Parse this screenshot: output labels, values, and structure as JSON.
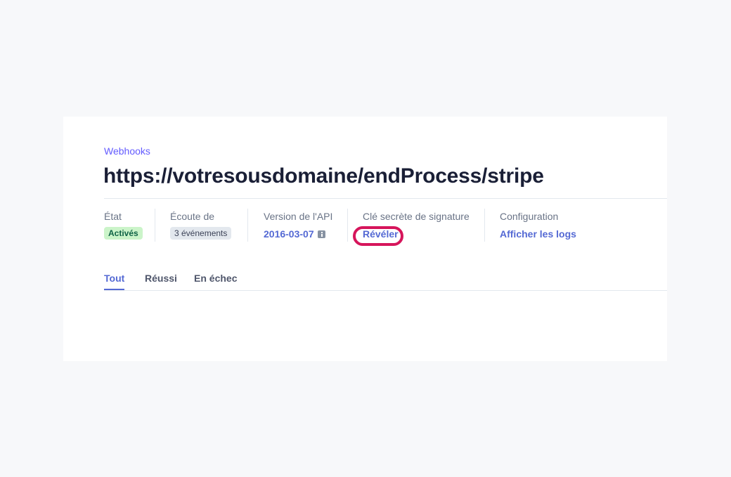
{
  "breadcrumb": "Webhooks",
  "title": "https://votresousdomaine/endProcess/stripe",
  "meta": {
    "state": {
      "label": "État",
      "value": "Activés"
    },
    "listening": {
      "label": "Écoute de",
      "value": "3 événements"
    },
    "api_version": {
      "label": "Version de l'API",
      "value": "2016-03-07"
    },
    "signing_secret": {
      "label": "Clé secrète de signature",
      "value": "Révéler"
    },
    "configuration": {
      "label": "Configuration",
      "value": "Afficher les logs"
    }
  },
  "tabs": [
    {
      "label": "Tout",
      "active": true
    },
    {
      "label": "Réussi",
      "active": false
    },
    {
      "label": "En échec",
      "active": false
    }
  ],
  "colors": {
    "accent": "#5469d4",
    "highlight_ring": "#d6155b",
    "success_badge": "#cbf4c9"
  },
  "icons": {
    "api_version_info": "info-icon"
  }
}
